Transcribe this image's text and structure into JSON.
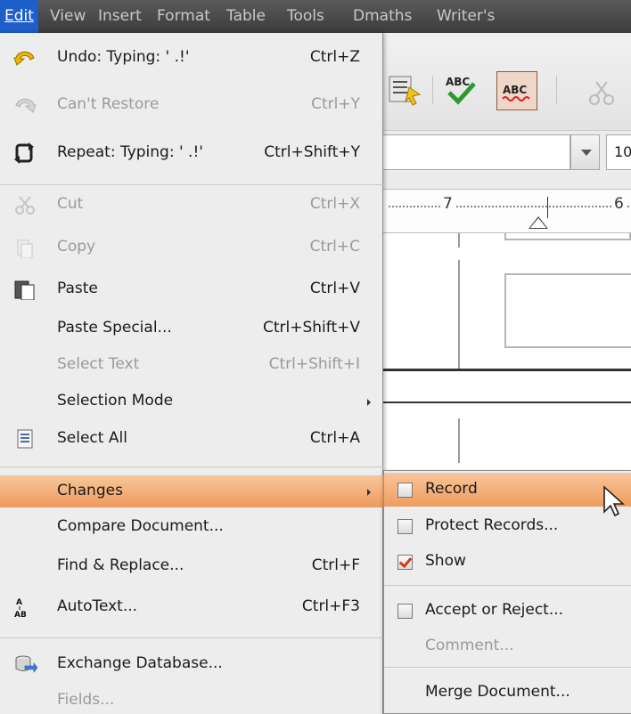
{
  "menubar": {
    "items": [
      "Edit",
      "View",
      "Insert",
      "Format",
      "Table",
      "Tools",
      "Dmaths",
      "Writer's"
    ]
  },
  "toolbar": {
    "font_size_value": "10",
    "ruler_numbers": [
      "7",
      "6"
    ]
  },
  "edit_menu": {
    "items": [
      {
        "label": "Undo: Typing: ' .!'",
        "shortcut": "Ctrl+Z",
        "enabled": true,
        "icon": "undo-icon"
      },
      {
        "label": "Can't Restore",
        "shortcut": "Ctrl+Y",
        "enabled": false,
        "icon": "redo-icon"
      },
      {
        "label": "Repeat: Typing: ' .!'",
        "shortcut": "Ctrl+Shift+Y",
        "enabled": true,
        "icon": "repeat-icon"
      },
      {
        "label": "Cut",
        "shortcut": "Ctrl+X",
        "enabled": false,
        "icon": "scissors-icon"
      },
      {
        "label": "Copy",
        "shortcut": "Ctrl+C",
        "enabled": false,
        "icon": "copy-icon"
      },
      {
        "label": "Paste",
        "shortcut": "Ctrl+V",
        "enabled": true,
        "icon": "paste-icon"
      },
      {
        "label": "Paste Special...",
        "shortcut": "Ctrl+Shift+V",
        "enabled": true
      },
      {
        "label": "Select Text",
        "shortcut": "Ctrl+Shift+I",
        "enabled": false
      },
      {
        "label": "Selection Mode",
        "shortcut": "",
        "enabled": true,
        "submenu": true
      },
      {
        "label": "Select All",
        "shortcut": "Ctrl+A",
        "enabled": true,
        "icon": "select-all-icon"
      },
      {
        "label": "Changes",
        "shortcut": "",
        "enabled": true,
        "submenu": true,
        "highlighted": true
      },
      {
        "label": "Compare Document...",
        "shortcut": "",
        "enabled": true
      },
      {
        "label": "Find & Replace...",
        "shortcut": "Ctrl+F",
        "enabled": true
      },
      {
        "label": "AutoText...",
        "shortcut": "Ctrl+F3",
        "enabled": true,
        "icon": "autotext-icon"
      },
      {
        "label": "Exchange Database...",
        "shortcut": "",
        "enabled": true,
        "icon": "database-icon"
      },
      {
        "label": "Fields...",
        "shortcut": "",
        "enabled": false
      }
    ]
  },
  "changes_submenu": {
    "items": [
      {
        "label": "Record",
        "checked": false,
        "highlighted": true,
        "enabled": true
      },
      {
        "label": "Protect Records...",
        "checked": false,
        "enabled": true
      },
      {
        "label": "Show",
        "checked": true,
        "enabled": true
      },
      {
        "label": "Accept or Reject...",
        "checked": false,
        "enabled": true
      },
      {
        "label": "Comment...",
        "enabled": false
      },
      {
        "label": "Merge Document...",
        "enabled": true
      }
    ]
  },
  "colors": {
    "menubar_bg": "#4a4a4a",
    "menubar_active": "#1e5ec9",
    "highlight": "#f0a063",
    "disabled_text": "#9a9a9a"
  }
}
